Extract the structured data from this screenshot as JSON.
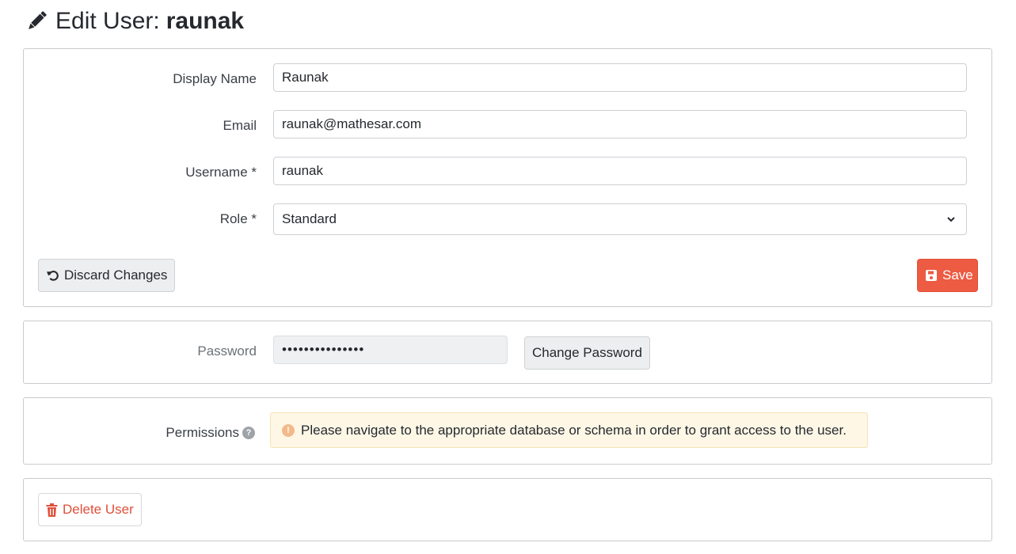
{
  "header": {
    "title_prefix": "Edit User:",
    "username": "raunak",
    "icon": "pencil-icon"
  },
  "profile_form": {
    "display_name": {
      "label": "Display Name",
      "value": "Raunak"
    },
    "email": {
      "label": "Email",
      "value": "raunak@mathesar.com"
    },
    "username": {
      "label": "Username *",
      "value": "raunak"
    },
    "role": {
      "label": "Role *",
      "selected": "Standard"
    },
    "discard_label": "Discard Changes",
    "save_label": "Save"
  },
  "password_section": {
    "label": "Password",
    "masked_value": "•••••••••••••••",
    "change_label": "Change Password"
  },
  "permissions_section": {
    "label": "Permissions",
    "help_icon": "question-circle-icon",
    "notice_text": "Please navigate to the appropriate database or schema in order to grant access to the user."
  },
  "delete_section": {
    "delete_label": "Delete User"
  },
  "colors": {
    "accent": "#ec5b42",
    "notice_bg": "#fef7e6",
    "danger": "#e04f3a"
  }
}
